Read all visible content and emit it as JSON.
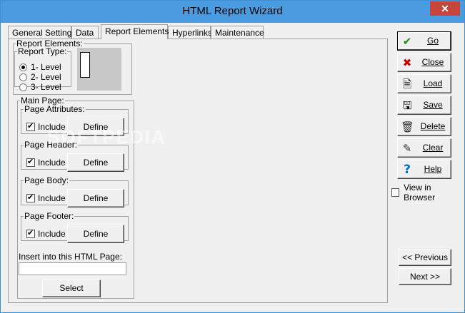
{
  "window": {
    "title": "HTML Report Wizard",
    "close_glyph": "✕"
  },
  "tabs": [
    {
      "label": "General Settings",
      "active": false
    },
    {
      "label": "Data",
      "active": false
    },
    {
      "label": "Report Elements",
      "active": true
    },
    {
      "label": "Hyperlinks",
      "active": false
    },
    {
      "label": "Maintenance",
      "active": false
    }
  ],
  "report_elements": {
    "legend": "Report Elements:",
    "report_type": {
      "legend": "Report Type:",
      "options": [
        {
          "label": "1- Level",
          "checked": true
        },
        {
          "label": "2- Level",
          "checked": false
        },
        {
          "label": "3- Level",
          "checked": false
        }
      ]
    },
    "main_page": {
      "legend": "Main Page:",
      "sections": [
        {
          "legend": "Page Attributes:",
          "include_label": "Include",
          "include_checked": true,
          "define_label": "Define"
        },
        {
          "legend": "Page Header:",
          "include_label": "Include",
          "include_checked": true,
          "define_label": "Define"
        },
        {
          "legend": "Page Body:",
          "include_label": "Include",
          "include_checked": true,
          "define_label": "Define"
        },
        {
          "legend": "Page Footer:",
          "include_label": "Include",
          "include_checked": true,
          "define_label": "Define"
        }
      ],
      "insert_label": "Insert into this HTML Page:",
      "insert_value": "",
      "select_label": "Select"
    }
  },
  "watermark": "SOFTPEDIA",
  "actions": [
    {
      "label": "Go",
      "icon": "check-icon",
      "glyph": "✔",
      "color": "#1a8a1a"
    },
    {
      "label": "Close",
      "icon": "close-x-icon",
      "glyph": "✖",
      "color": "#c00000"
    },
    {
      "label": "Load",
      "icon": "document-icon",
      "glyph": "🗎",
      "color": "#000000"
    },
    {
      "label": "Save",
      "icon": "save-document-icon",
      "glyph": "🖫",
      "color": "#000000"
    },
    {
      "label": "Delete",
      "icon": "trash-icon",
      "glyph": "🗑",
      "color": "#333333"
    },
    {
      "label": "Clear",
      "icon": "eraser-icon",
      "glyph": "✎",
      "color": "#333333"
    },
    {
      "label": "Help",
      "icon": "question-icon",
      "glyph": "?",
      "color": "#0070c0"
    }
  ],
  "view_in_browser": {
    "label": "View in Browser",
    "checked": false
  },
  "nav": {
    "previous_label": "<< Previous",
    "next_label": "Next >>"
  }
}
